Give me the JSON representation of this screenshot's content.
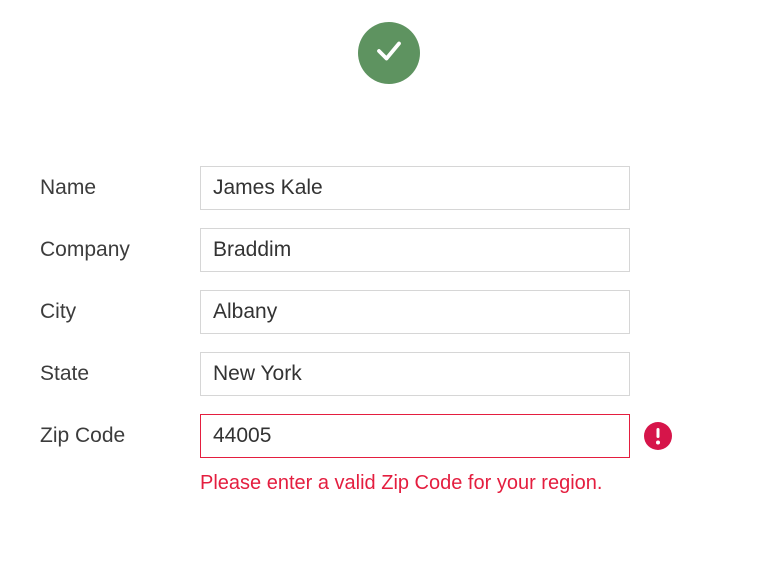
{
  "status_icon": "checkmark",
  "form": {
    "fields": [
      {
        "label": "Name",
        "value": "James Kale",
        "hasError": false
      },
      {
        "label": "Company",
        "value": "Braddim",
        "hasError": false
      },
      {
        "label": "City",
        "value": "Albany",
        "hasError": false
      },
      {
        "label": "State",
        "value": "New York",
        "hasError": false
      },
      {
        "label": "Zip Code",
        "value": "44005",
        "hasError": true,
        "errorMessage": "Please enter a valid Zip Code for your region."
      }
    ]
  },
  "colors": {
    "successBadge": "#5e9360",
    "errorBorder": "#e41e3f",
    "errorIcon": "#d6154a",
    "inputBorder": "#d6d6d6"
  }
}
